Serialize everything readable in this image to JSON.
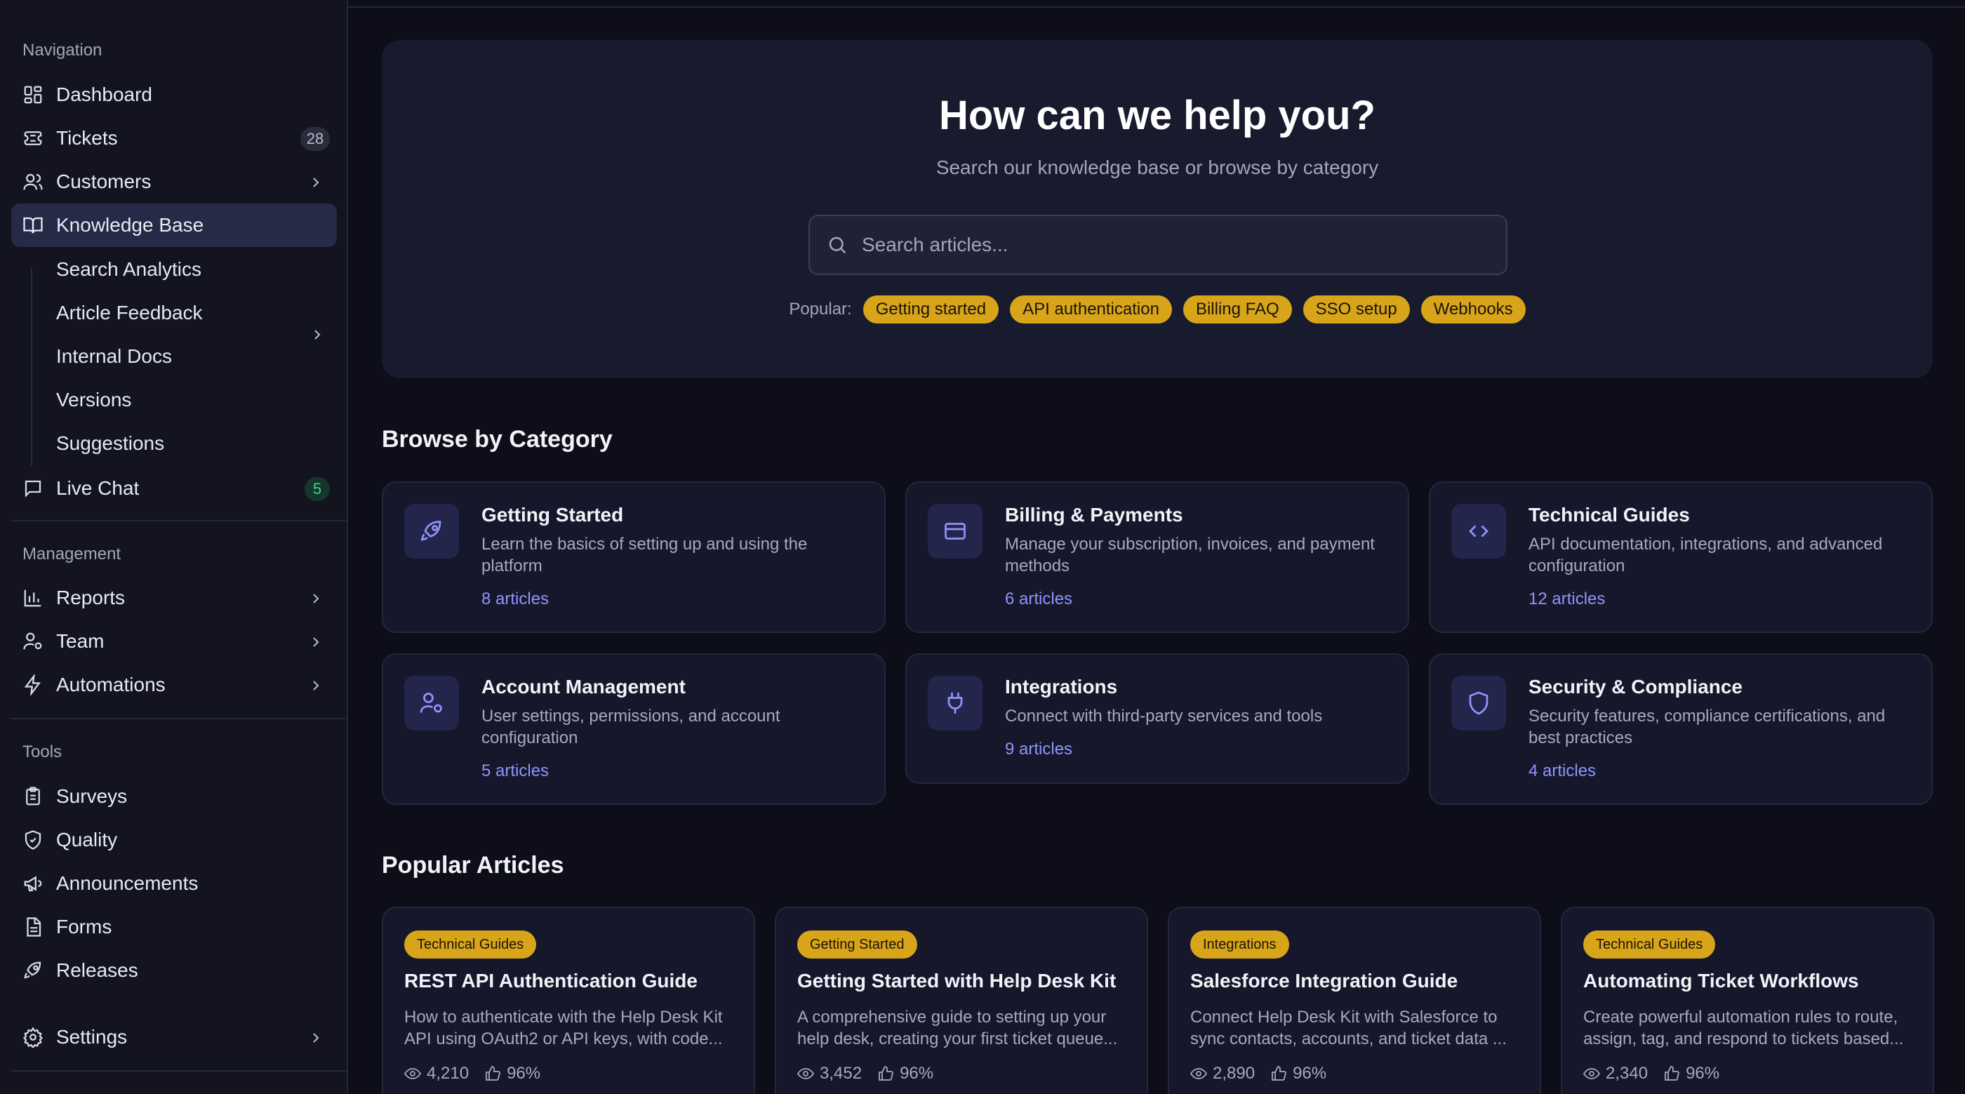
{
  "sidebar": {
    "navigation_label": "Navigation",
    "items": [
      {
        "label": "Dashboard"
      },
      {
        "label": "Tickets",
        "badge": "28"
      },
      {
        "label": "Customers"
      },
      {
        "label": "Knowledge Base"
      },
      {
        "label": "Live Chat",
        "badge": "5"
      }
    ],
    "kb_subitems": [
      "Search Analytics",
      "Article Feedback",
      "Internal Docs",
      "Versions",
      "Suggestions"
    ],
    "management_label": "Management",
    "management_items": [
      {
        "label": "Reports"
      },
      {
        "label": "Team"
      },
      {
        "label": "Automations"
      }
    ],
    "tools_label": "Tools",
    "tools_items": [
      {
        "label": "Surveys"
      },
      {
        "label": "Quality"
      },
      {
        "label": "Announcements"
      },
      {
        "label": "Forms"
      },
      {
        "label": "Releases"
      }
    ],
    "settings_label": "Settings"
  },
  "hero": {
    "title": "How can we help you?",
    "subtitle": "Search our knowledge base or browse by category",
    "search_placeholder": "Search articles...",
    "popular_label": "Popular:",
    "popular_tags": [
      "Getting started",
      "API authentication",
      "Billing FAQ",
      "SSO setup",
      "Webhooks"
    ]
  },
  "categories": {
    "heading": "Browse by Category",
    "items": [
      {
        "title": "Getting Started",
        "description": "Learn the basics of setting up and using the platform",
        "count": "8 articles",
        "icon": "rocket-icon"
      },
      {
        "title": "Billing & Payments",
        "description": "Manage your subscription, invoices, and payment methods",
        "count": "6 articles",
        "icon": "credit-card-icon"
      },
      {
        "title": "Technical Guides",
        "description": "API documentation, integrations, and advanced configuration",
        "count": "12 articles",
        "icon": "code-icon"
      },
      {
        "title": "Account Management",
        "description": "User settings, permissions, and account configuration",
        "count": "5 articles",
        "icon": "user-settings-icon"
      },
      {
        "title": "Integrations",
        "description": "Connect with third-party services and tools",
        "count": "9 articles",
        "icon": "plug-icon"
      },
      {
        "title": "Security & Compliance",
        "description": "Security features, compliance certifications, and best practices",
        "count": "4 articles",
        "icon": "shield-icon"
      }
    ]
  },
  "popular_articles": {
    "heading": "Popular Articles",
    "items": [
      {
        "tag": "Technical Guides",
        "title": "REST API Authentication Guide",
        "description": "How to authenticate with the Help Desk Kit API using OAuth2 or API keys, with code...",
        "views": "4,210",
        "helpful": "96%"
      },
      {
        "tag": "Getting Started",
        "title": "Getting Started with Help Desk Kit",
        "description": "A comprehensive guide to setting up your help desk, creating your first ticket queue...",
        "views": "3,452",
        "helpful": "96%"
      },
      {
        "tag": "Integrations",
        "title": "Salesforce Integration Guide",
        "description": "Connect Help Desk Kit with Salesforce to sync contacts, accounts, and ticket data ...",
        "views": "2,890",
        "helpful": "96%"
      },
      {
        "tag": "Technical Guides",
        "title": "Automating Ticket Workflows",
        "description": "Create powerful automation rules to route, assign, tag, and respond to tickets based...",
        "views": "2,340",
        "helpful": "96%"
      }
    ]
  },
  "colors": {
    "accent_link": "#8f94ff",
    "tag_yellow": "#d8a51a",
    "badge_green": "#3fd58a",
    "background": "#0d0e1a"
  }
}
